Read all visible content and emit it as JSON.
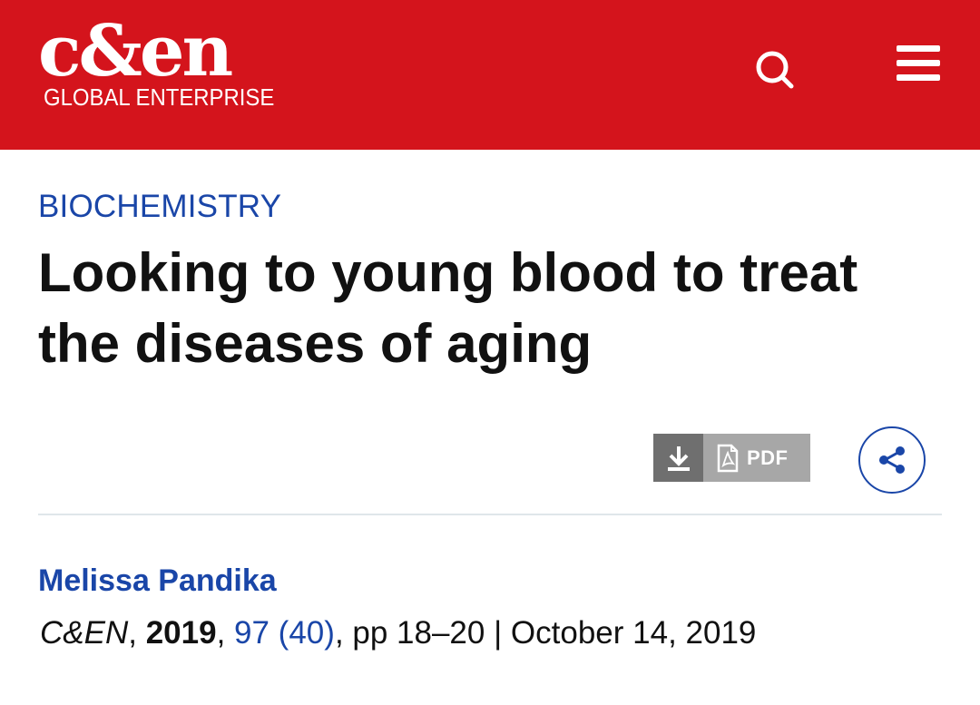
{
  "header": {
    "logo_text": "c&en",
    "logo_subtitle": "GLOBAL ENTERPRISE",
    "search_icon": "search-icon",
    "menu_icon": "hamburger-menu-icon",
    "background_color": "#d4141c"
  },
  "article": {
    "category": "BIOCHEMISTRY",
    "title": "Looking to young blood to treat the diseases of aging",
    "pdf_label": "PDF",
    "download_icon": "download-icon",
    "pdf_icon": "pdf-file-icon",
    "share_icon": "share-icon",
    "author": "Melissa Pandika",
    "citation": {
      "journal": "C&EN",
      "sep1": ", ",
      "year": "2019",
      "sep2": ", ",
      "volume_issue": "97 (40)",
      "pages": ", pp 18–20 | ",
      "date": "October 14, 2019"
    }
  },
  "colors": {
    "accent_blue": "#1a46a8",
    "brand_red": "#d4141c"
  }
}
